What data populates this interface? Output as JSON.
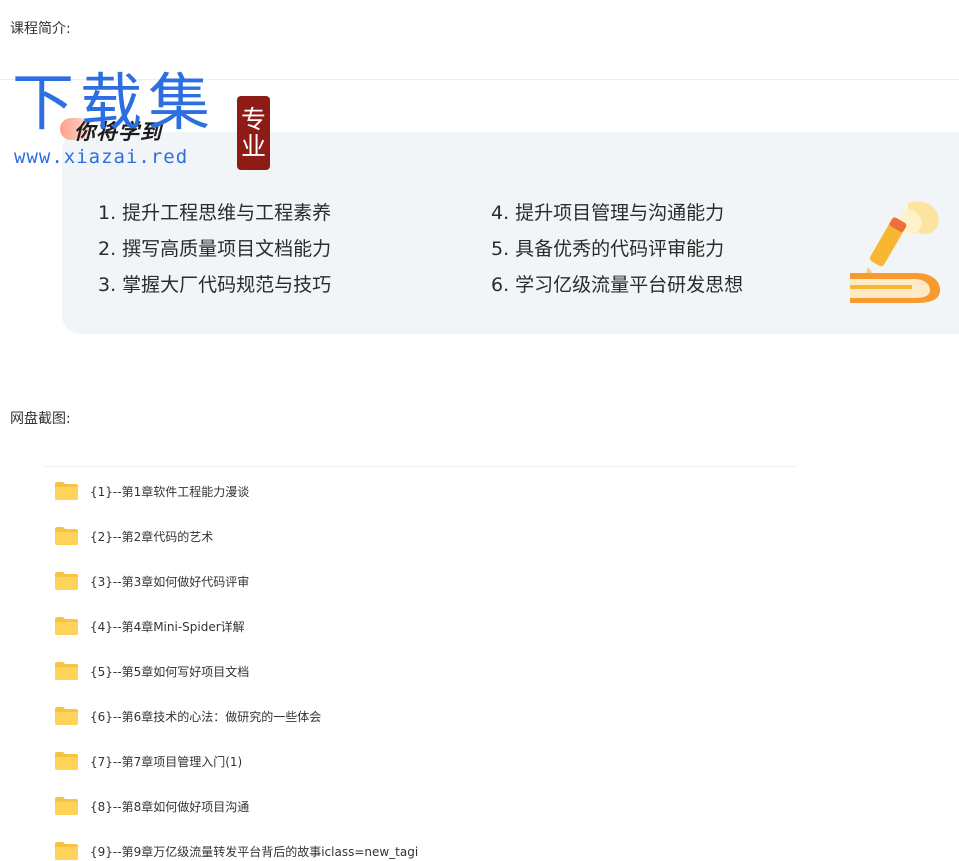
{
  "intro_label": "课程简介:",
  "watermark": {
    "big_text": "下载集",
    "url_text": "www.xiazai.red",
    "seal_chars": [
      "专",
      "业"
    ]
  },
  "banner": {
    "title": "你将学到",
    "points_left": [
      "1. 提升工程思维与工程素养",
      "2. 撰写高质量项目文档能力",
      "3. 掌握大厂代码规范与技巧"
    ],
    "points_right": [
      "4. 提升项目管理与沟通能力",
      "5. 具备优秀的代码评审能力",
      "6. 学习亿级流量平台研发思想"
    ]
  },
  "disk_label": "网盘截图:",
  "files": [
    "{1}--第1章软件工程能力漫谈",
    "{2}--第2章代码的艺术",
    "{3}--第3章如何做好代码评审",
    "{4}--第4章Mini-Spider详解",
    "{5}--第5章如何写好项目文档",
    "{6}--第6章技术的心法：做研究的一些体会",
    "{7}--第7章项目管理入门(1)",
    "{8}--第8章如何做好项目沟通",
    "{9}--第9章万亿级流量转发平台背后的故事iclass=new_tagi"
  ],
  "colors": {
    "watermark_blue": "#2c6fe0",
    "seal_red": "#8e1b16",
    "folder_yellow": "#f6c343"
  }
}
